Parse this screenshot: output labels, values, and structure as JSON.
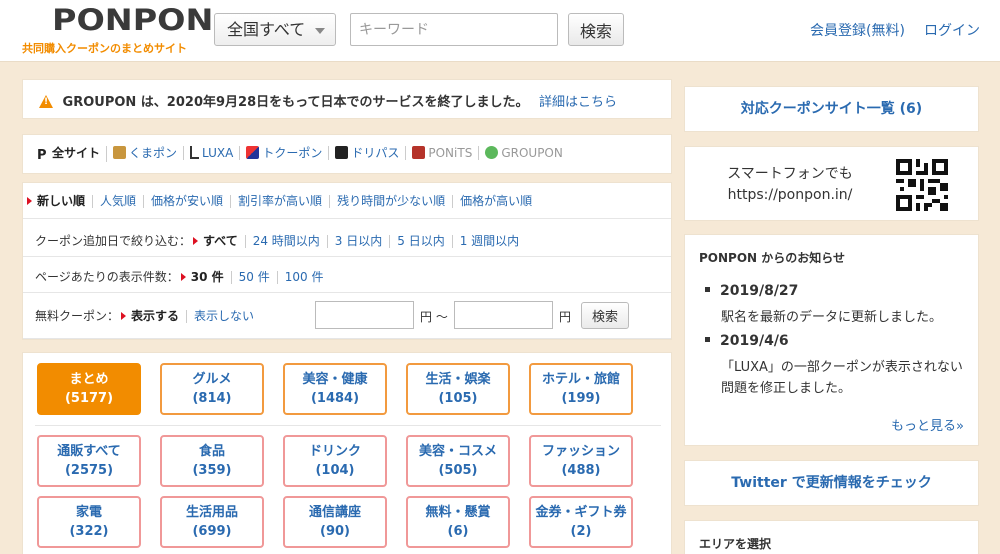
{
  "header": {
    "logo": "PONPON",
    "tagline": "共同購入クーポンのまとめサイト",
    "region_selected": "全国すべて",
    "keyword_placeholder": "キーワード",
    "search_label": "検索",
    "register": "会員登録(無料)",
    "login": "ログイン"
  },
  "notice": {
    "text": "GROUPON は、2020年9月28日をもって日本でのサービスを終了しました。",
    "detail_link": "詳細はこちら"
  },
  "sites": [
    "全サイト",
    "くまポン",
    "LUXA",
    "トクーポン",
    "ドリパス",
    "PONiTS",
    "GROUPON"
  ],
  "filters": {
    "sort": [
      "新しい順",
      "人気順",
      "価格が安い順",
      "割引率が高い順",
      "残り時間が少ない順",
      "価格が高い順"
    ],
    "added_label": "クーポン追加日で絞り込む：",
    "added": [
      "すべて",
      "24 時間以内",
      "3 日以内",
      "5 日以内",
      "1 週間以内"
    ],
    "per_page_label": "ページあたりの表示件数：",
    "per_page": [
      "30 件",
      "50 件",
      "100 件"
    ],
    "free_label": "無料クーポン：",
    "free": [
      "表示する",
      "表示しない"
    ],
    "yen": "円",
    "tilde": "円 ～",
    "search_label": "検索"
  },
  "categories": {
    "row1": [
      {
        "name": "まとめ",
        "count": "(5177)"
      },
      {
        "name": "グルメ",
        "count": "(814)"
      },
      {
        "name": "美容・健康",
        "count": "(1484)"
      },
      {
        "name": "生活・娯楽",
        "count": "(105)"
      },
      {
        "name": "ホテル・旅館",
        "count": "(199)"
      }
    ],
    "row2": [
      {
        "name": "通販すべて",
        "count": "(2575)"
      },
      {
        "name": "食品",
        "count": "(359)"
      },
      {
        "name": "ドリンク",
        "count": "(104)"
      },
      {
        "name": "美容・コスメ",
        "count": "(505)"
      },
      {
        "name": "ファッション",
        "count": "(488)"
      }
    ],
    "row3": [
      {
        "name": "家電",
        "count": "(322)"
      },
      {
        "name": "生活用品",
        "count": "(699)"
      },
      {
        "name": "通信講座",
        "count": "(90)"
      },
      {
        "name": "無料・懸賞",
        "count": "(6)"
      },
      {
        "name": "金券・ギフト券",
        "count": "(2)"
      }
    ]
  },
  "sidebar": {
    "sites_link": "対応クーポンサイト一覧 (6)",
    "smartphone_line1": "スマートフォンでも",
    "smartphone_line2": "https://ponpon.in/",
    "news_title": "PONPON からのお知らせ",
    "news": [
      {
        "date": "2019/8/27",
        "body": "駅名を最新のデータに更新しました。"
      },
      {
        "date": "2019/4/6",
        "body": "「LUXA」の一部クーポンが表示されない問題を修正しました。"
      }
    ],
    "more": "もっと見る»",
    "twitter": "Twitter で更新情報をチェック",
    "area": "エリアを選択"
  },
  "colors": {
    "accent": "#f28c00",
    "link": "#2a6ab0",
    "background": "#f6e9d6"
  }
}
